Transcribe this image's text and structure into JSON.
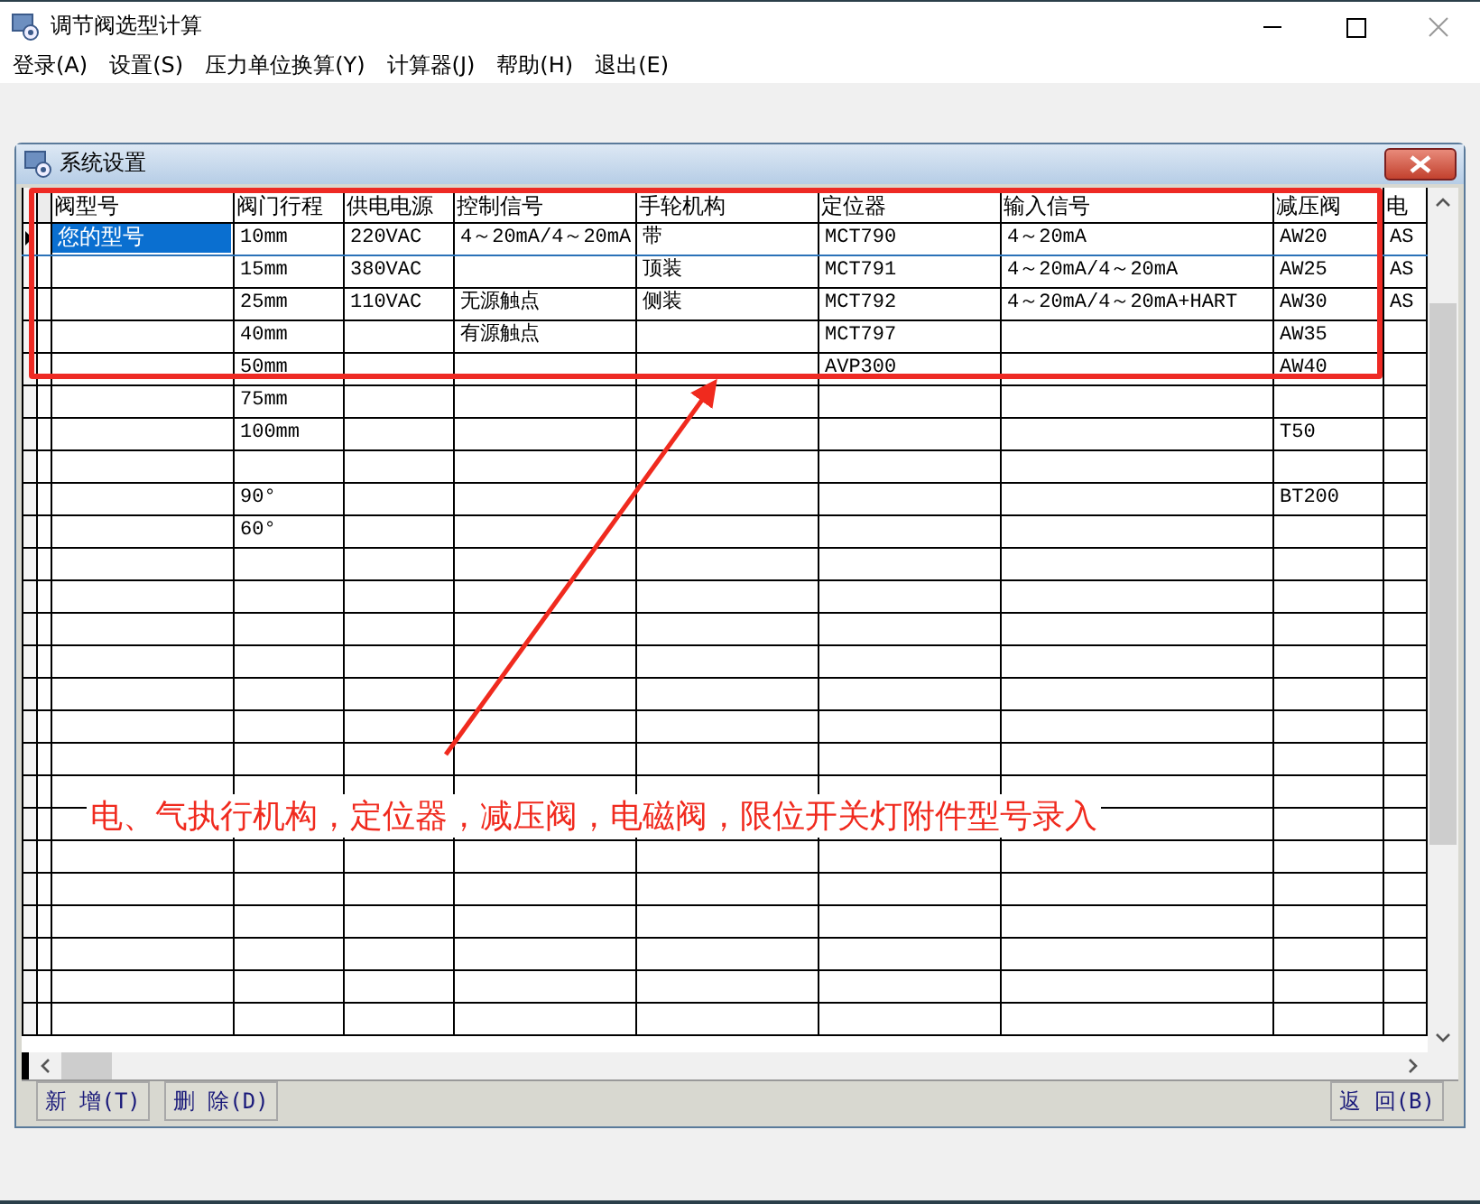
{
  "window": {
    "title": "调节阀选型计算"
  },
  "menu": [
    {
      "label": "登录(A)"
    },
    {
      "label": "设置(S)"
    },
    {
      "label": "压力单位换算(Y)"
    },
    {
      "label": "计算器(J)"
    },
    {
      "label": "帮助(H)"
    },
    {
      "label": "退出(E)"
    }
  ],
  "dialog": {
    "title": "系统设置",
    "table": {
      "columns": [
        "阀型号",
        "阀门行程",
        "供电电源",
        "控制信号",
        "手轮机构",
        "定位器",
        "输入信号",
        "减压阀",
        "电"
      ],
      "rows": [
        {
          "selected": true,
          "cells": [
            "您的型号",
            "10mm",
            "220VAC",
            "4～20mA/4～20mA",
            "带",
            "MCT790",
            "4～20mA",
            "AW20",
            "AS"
          ]
        },
        {
          "selected": false,
          "cells": [
            null,
            "15mm",
            "380VAC",
            null,
            "顶装",
            "MCT791",
            "4～20mA/4～20mA",
            "AW25",
            "AS"
          ]
        },
        {
          "selected": false,
          "cells": [
            null,
            "25mm",
            "110VAC",
            "无源触点",
            "侧装",
            "MCT792",
            "4～20mA/4～20mA+HART",
            "AW30",
            "AS"
          ]
        },
        {
          "selected": false,
          "cells": [
            null,
            "40mm",
            null,
            "有源触点",
            null,
            "MCT797",
            null,
            "AW35",
            null
          ]
        },
        {
          "selected": false,
          "cells": [
            null,
            "50mm",
            null,
            null,
            null,
            "AVP300",
            null,
            "AW40",
            null
          ]
        },
        {
          "selected": false,
          "cells": [
            null,
            "75mm",
            null,
            null,
            null,
            null,
            null,
            null,
            null
          ]
        },
        {
          "selected": false,
          "cells": [
            null,
            "100mm",
            null,
            null,
            null,
            null,
            null,
            "T50",
            null
          ]
        },
        {
          "selected": false,
          "cells": [
            null,
            null,
            null,
            null,
            null,
            null,
            null,
            null,
            null
          ]
        },
        {
          "selected": false,
          "cells": [
            null,
            "90°",
            null,
            null,
            null,
            null,
            null,
            "BT200",
            null
          ]
        },
        {
          "selected": false,
          "cells": [
            null,
            "60°",
            null,
            null,
            null,
            null,
            null,
            null,
            null
          ]
        }
      ]
    },
    "buttons_left": [
      {
        "label": "新 增(T)"
      },
      {
        "label": "删 除(D)"
      }
    ],
    "buttons_right": [
      {
        "label": "返 回(B)"
      }
    ]
  },
  "annotation": {
    "text": "电、气执行机构，定位器，减压阀，电磁阀，限位开关灯附件型号录入"
  }
}
